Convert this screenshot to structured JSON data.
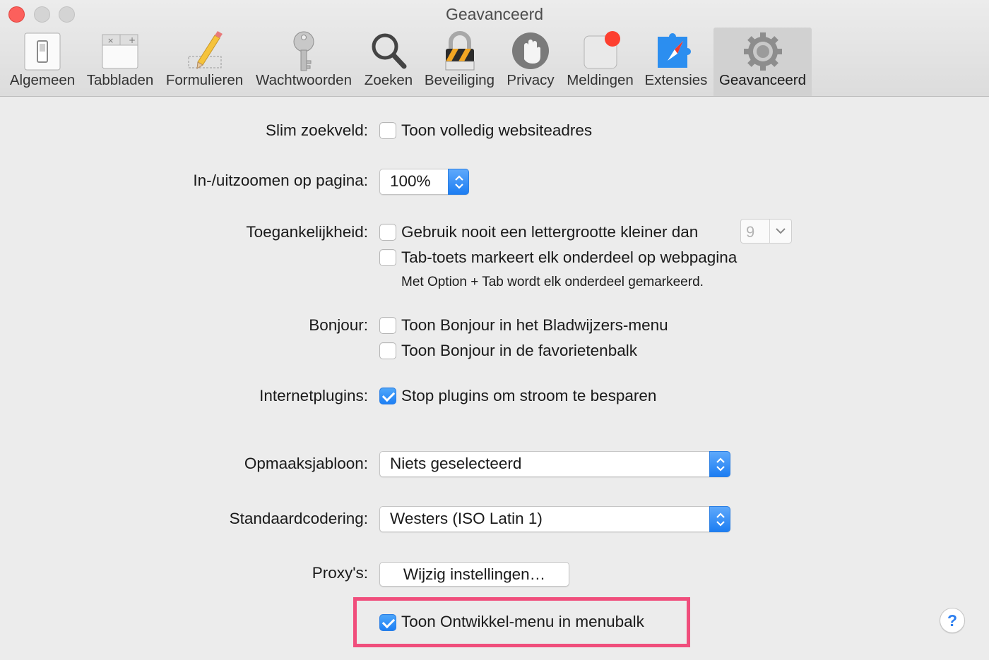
{
  "window": {
    "title": "Geavanceerd"
  },
  "toolbar": {
    "tabs": [
      {
        "label": "Algemeen",
        "icon": "switch-icon"
      },
      {
        "label": "Tabbladen",
        "icon": "tabs-icon"
      },
      {
        "label": "Formulieren",
        "icon": "pencil-icon"
      },
      {
        "label": "Wachtwoorden",
        "icon": "key-icon"
      },
      {
        "label": "Zoeken",
        "icon": "magnifier-icon"
      },
      {
        "label": "Beveiliging",
        "icon": "padlock-icon"
      },
      {
        "label": "Privacy",
        "icon": "hand-icon"
      },
      {
        "label": "Meldingen",
        "icon": "notification-icon"
      },
      {
        "label": "Extensies",
        "icon": "puzzle-compass-icon"
      },
      {
        "label": "Geavanceerd",
        "icon": "gear-icon",
        "selected": true
      }
    ]
  },
  "settings": {
    "smart_search": {
      "label": "Slim zoekveld:",
      "option": "Toon volledig websiteadres",
      "checked": false
    },
    "zoom": {
      "label": "In-/uitzoomen op pagina:",
      "value": "100%"
    },
    "accessibility": {
      "label": "Toegankelijkheid:",
      "min_font_option": "Gebruik nooit een lettergrootte kleiner dan",
      "min_font_checked": false,
      "min_font_value": "9",
      "tab_option": "Tab-toets markeert elk onderdeel op webpagina",
      "tab_checked": false,
      "tab_note": "Met Option + Tab wordt elk onderdeel gemarkeerd."
    },
    "bonjour": {
      "label": "Bonjour:",
      "bookmarks_option": "Toon Bonjour in het Bladwijzers-menu",
      "bookmarks_checked": false,
      "favorites_option": "Toon Bonjour in de favorietenbalk",
      "favorites_checked": false
    },
    "plugins": {
      "label": "Internetplugins:",
      "option": "Stop plugins om stroom te besparen",
      "checked": true
    },
    "stylesheet": {
      "label": "Opmaaksjabloon:",
      "value": "Niets geselecteerd"
    },
    "encoding": {
      "label": "Standaardcodering:",
      "value": "Westers (ISO Latin 1)"
    },
    "proxies": {
      "label": "Proxy's:",
      "button": "Wijzig instellingen…"
    },
    "develop_menu": {
      "option": "Toon Ontwikkel-menu in menubalk",
      "checked": true
    }
  },
  "help": {
    "label": "?"
  },
  "colors": {
    "accent": "#1d7ff4",
    "highlight": "#f04e7c",
    "close": "#fc605c"
  }
}
